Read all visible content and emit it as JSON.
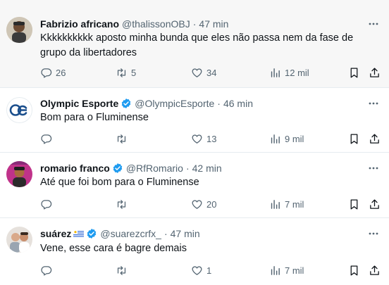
{
  "tweets": [
    {
      "display_name": "Fabrizio africano",
      "handle": "@thalissonOBJ",
      "separator": "·",
      "time": "47 min",
      "text_line1": "Kkkkkkkkkk aposto minha bunda que eles não passa nem da fase de",
      "text_line2": "grupo da libertadores",
      "replies": "26",
      "retweets": "5",
      "likes": "34",
      "views": "12 mil",
      "verified": false
    },
    {
      "display_name": "Olympic Esporte",
      "handle": "@OlympicEsporte",
      "separator": "·",
      "time": "46 min",
      "text_line1": "Bom para o Fluminense",
      "replies": "",
      "retweets": "",
      "likes": "13",
      "views": "9 mil",
      "verified": true
    },
    {
      "display_name": "romario franco",
      "handle": "@RfRomario",
      "separator": "·",
      "time": "42 min",
      "text_line1": "Até que foi bom para o Fluminense",
      "replies": "",
      "retweets": "",
      "likes": "20",
      "views": "7 mil",
      "verified": true
    },
    {
      "display_name": "suárez",
      "handle": "@suarezcrfx_",
      "separator": "·",
      "time": "47 min",
      "text_line1": "Vene, esse cara é bagre demais",
      "replies": "",
      "retweets": "",
      "likes": "1",
      "views": "7 mil",
      "verified": true,
      "flag": "uruguay-flag"
    }
  ],
  "colors": {
    "verified_blue": "#1d9bf0",
    "icon_gray": "#536471",
    "highlight_bg": "#f7f7f7"
  },
  "icons": [
    "reply-icon",
    "retweet-icon",
    "like-icon",
    "views-icon",
    "bookmark-icon",
    "share-icon",
    "more-icon",
    "verified-icon"
  ]
}
